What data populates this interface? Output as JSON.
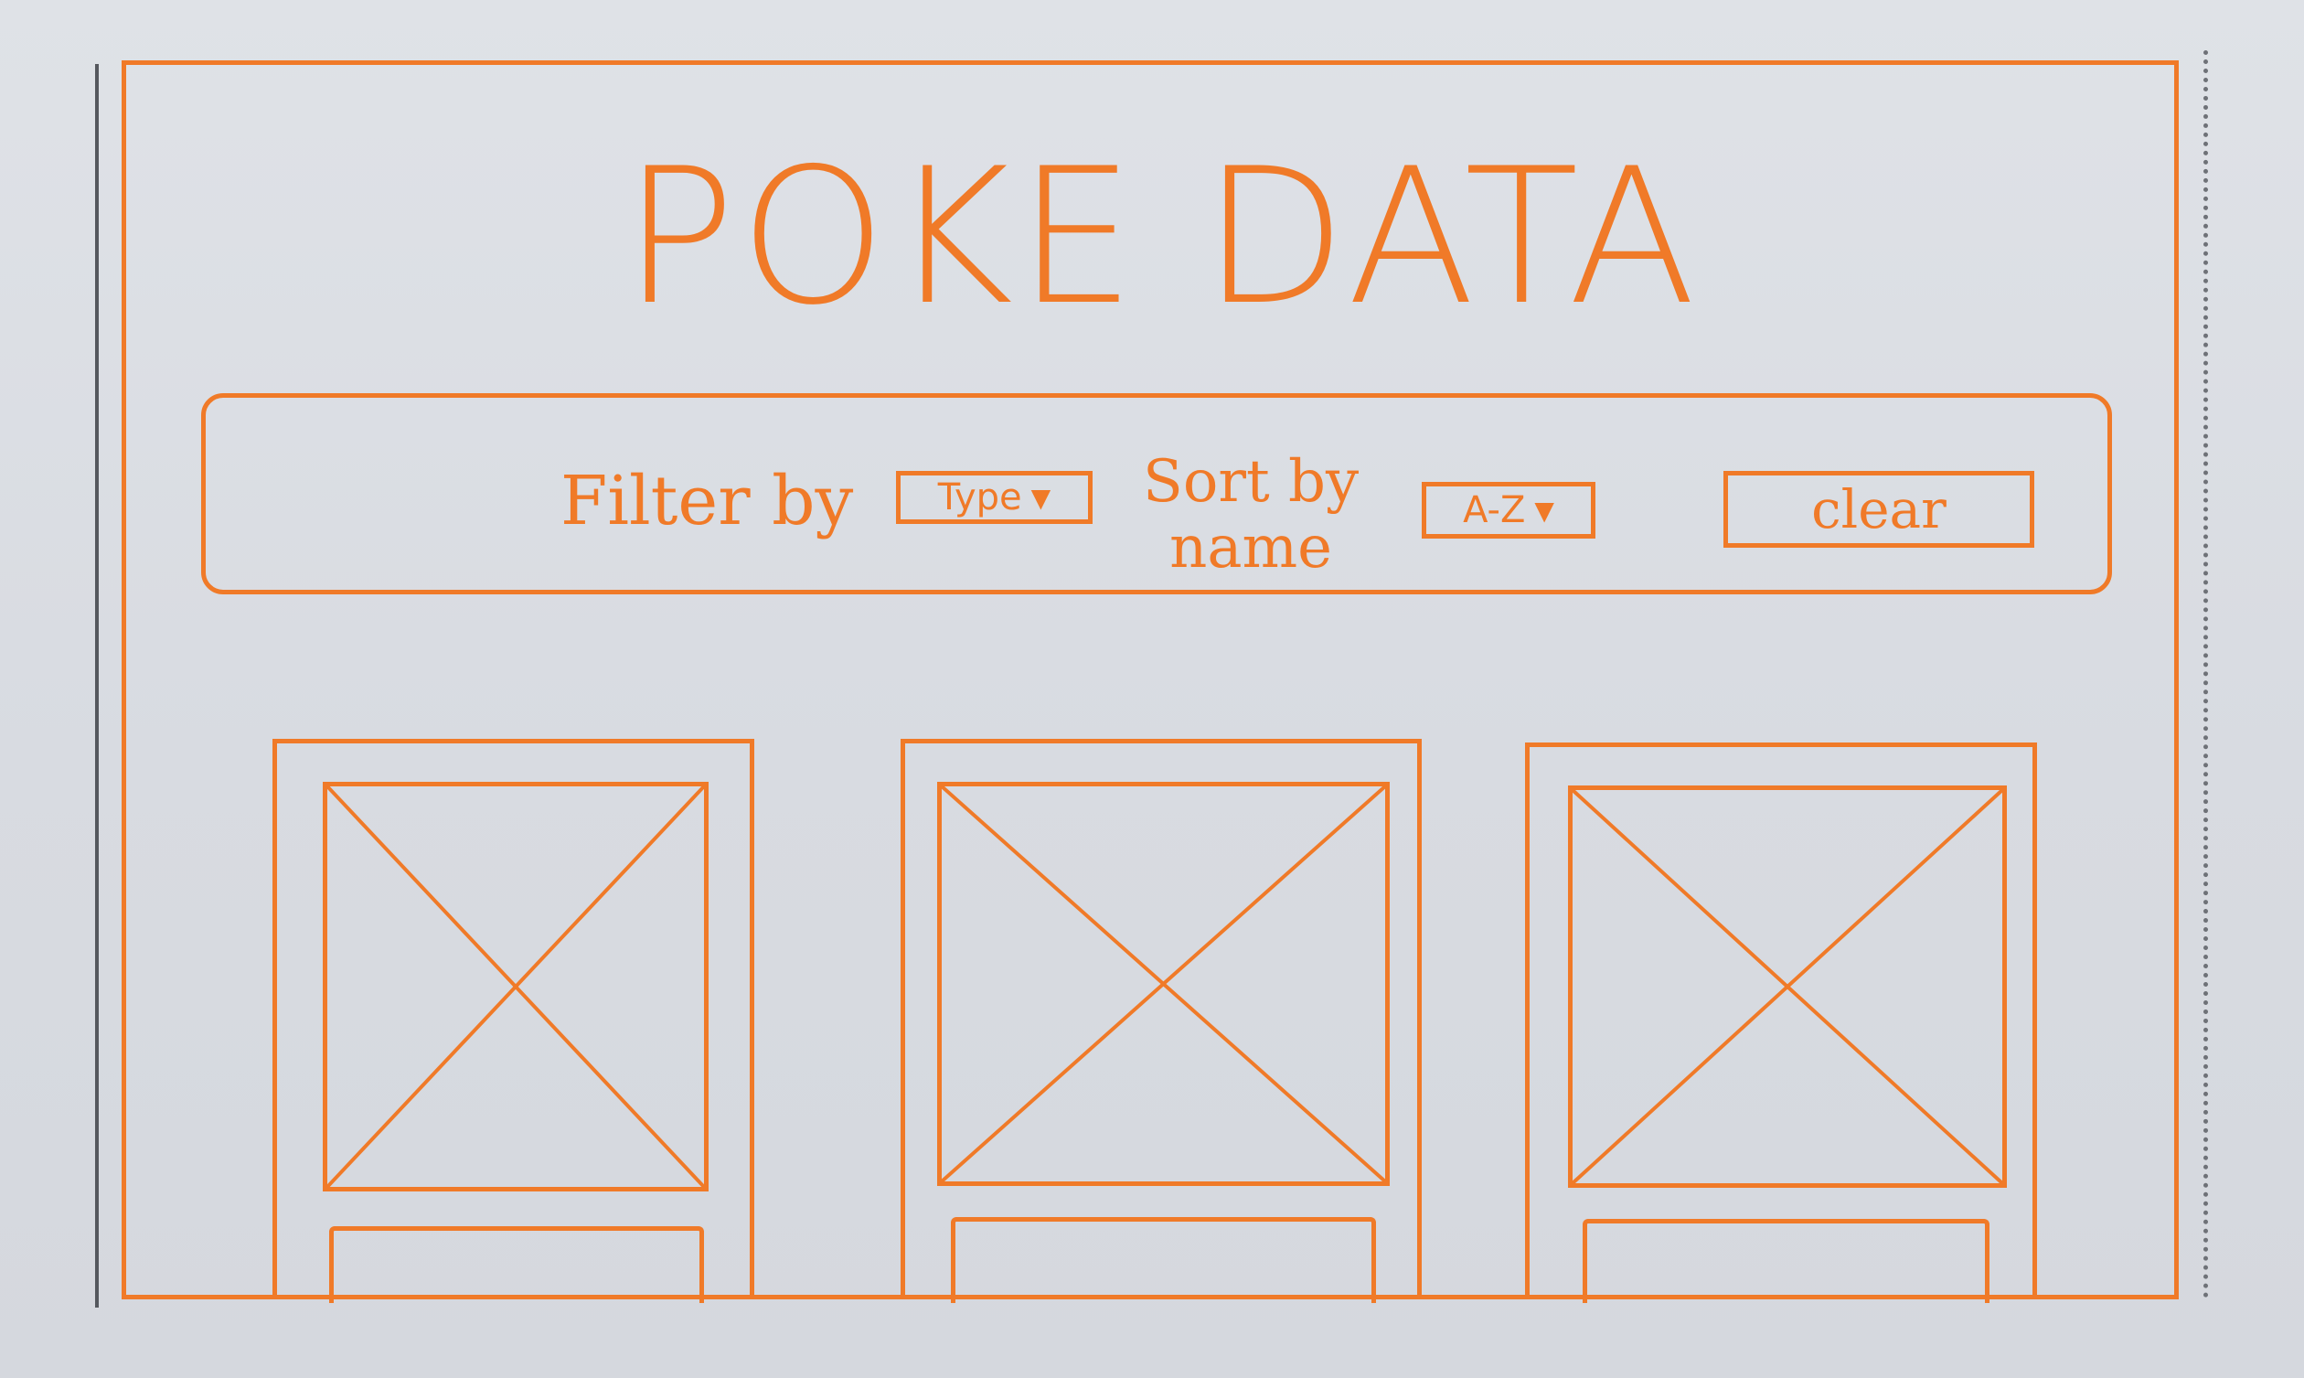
{
  "app": {
    "title": "POKE DATA"
  },
  "toolbar": {
    "filter_label": "Filter by",
    "type_select_value": "Type",
    "sort_label_line1": "Sort by",
    "sort_label_line2": "name",
    "sort_select_value": "A-Z",
    "clear_label": "clear"
  },
  "cards": [
    {
      "image_icon": "image-placeholder-icon"
    },
    {
      "image_icon": "image-placeholder-icon"
    },
    {
      "image_icon": "image-placeholder-icon"
    }
  ],
  "colors": {
    "accent": "#f07a28",
    "paper": "#dadde2"
  }
}
